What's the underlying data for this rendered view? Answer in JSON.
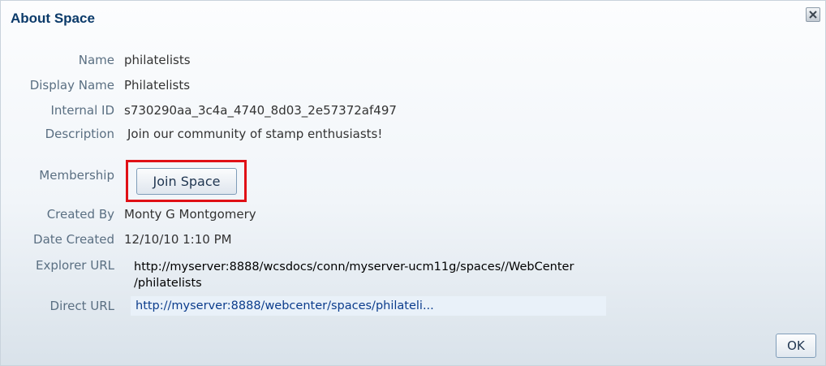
{
  "dialog": {
    "title": "About Space",
    "close_icon": "close-x-icon",
    "ok_label": "OK"
  },
  "fields": {
    "name": {
      "label": "Name",
      "value": "philatelists"
    },
    "display_name": {
      "label": "Display Name",
      "value": "Philatelists"
    },
    "internal_id": {
      "label": "Internal ID",
      "value": "s730290aa_3c4a_4740_8d03_2e57372af497"
    },
    "description": {
      "label": "Description",
      "value": "Join our community of stamp enthusiasts!"
    },
    "membership": {
      "label": "Membership",
      "button_label": "Join Space"
    },
    "created_by": {
      "label": "Created By",
      "value": "Monty G Montgomery"
    },
    "date_created": {
      "label": "Date Created",
      "value": "12/10/10 1:10 PM"
    },
    "explorer_url": {
      "label": "Explorer URL",
      "value_line1": "http://myserver:8888/wcsdocs/conn/myserver-ucm11g/spaces//WebCenter",
      "value_line2": "/philatelists"
    },
    "direct_url": {
      "label": "Direct URL",
      "value": "http://myserver:8888/webcenter/spaces/philateli..."
    }
  },
  "colors": {
    "title": "#0b3a6a",
    "label": "#5a6f82",
    "highlight_outline": "#e01016",
    "link": "#0b3c8c"
  }
}
